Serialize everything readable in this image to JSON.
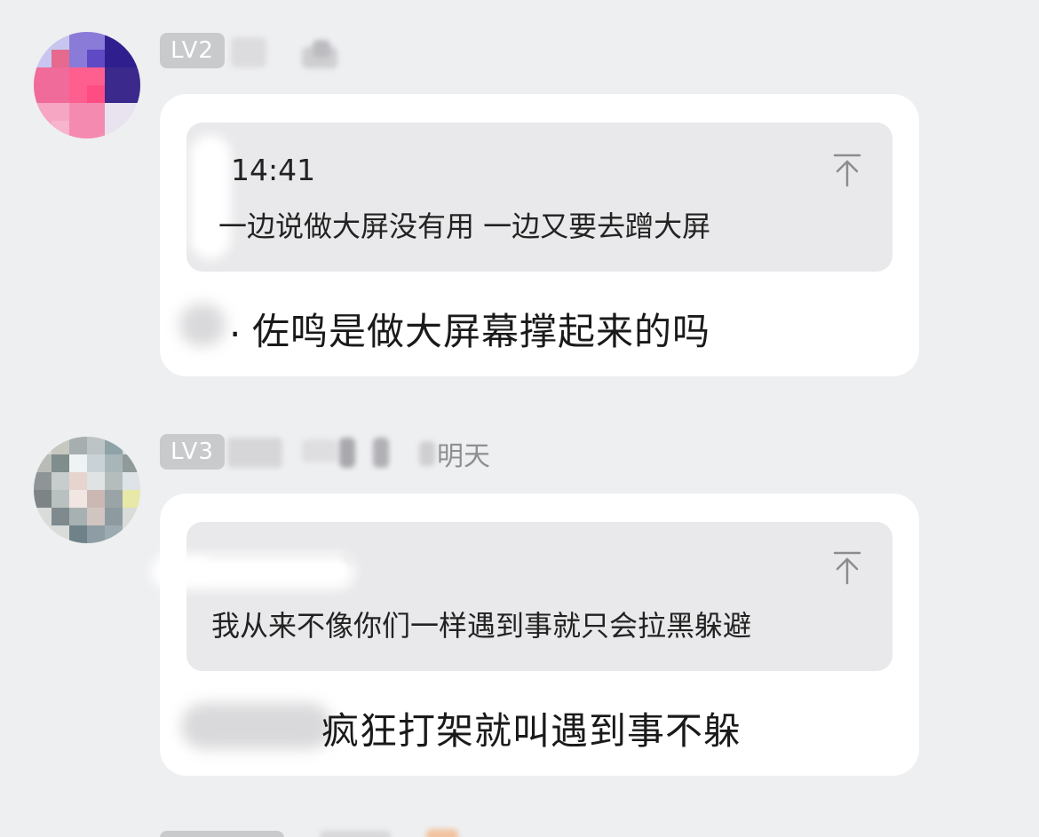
{
  "messages": [
    {
      "level_badge": "LV2",
      "name_suffix": "",
      "quote": {
        "time": "14:41",
        "text": "一边说做大屏没有用 一边又要去蹭大屏"
      },
      "reply": "佐鸣是做大屏幕撑起来的吗",
      "reply_prefix": "."
    },
    {
      "level_badge": "LV3",
      "name_suffix": "明天",
      "quote": {
        "time": "",
        "text": "我从来不像你们一样遇到事就只会拉黑躲避"
      },
      "reply": "疯狂打架就叫遇到事不躲",
      "reply_prefix": ""
    }
  ],
  "icons": {
    "pin": "pin-to-top-icon"
  },
  "colors": {
    "background": "#eeeff1",
    "bubble": "#ffffff",
    "quote_bg": "#e9e9eb",
    "badge_bg": "#c9cacc"
  }
}
